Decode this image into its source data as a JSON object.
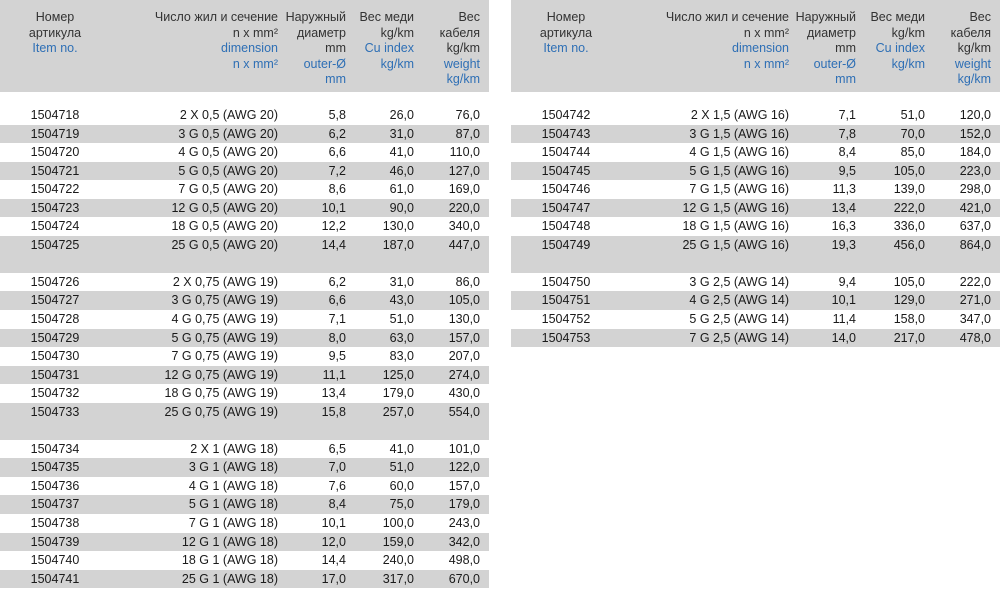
{
  "headers": {
    "item_ru": "Номер\nартикула",
    "item_en": "Item no.",
    "dim_ru": "Число жил и сечение\nn x mm²",
    "dim_en": "dimension\nn x mm²",
    "od_ru": "Наружный\nдиаметр\nmm",
    "od_en": "outer-Ø\nmm",
    "cu_ru": "Вес меди\nkg/km",
    "cu_en": "Cu index\nkg/km",
    "wt_ru": "Вес\nкабеля\nkg/km",
    "wt_en": "weight\nkg/km"
  },
  "left_groups": [
    [
      [
        "1504718",
        "2 X 0,5 (AWG 20)",
        "5,8",
        "26,0",
        "76,0"
      ],
      [
        "1504719",
        "3 G 0,5 (AWG 20)",
        "6,2",
        "31,0",
        "87,0"
      ],
      [
        "1504720",
        "4 G 0,5 (AWG 20)",
        "6,6",
        "41,0",
        "110,0"
      ],
      [
        "1504721",
        "5 G 0,5 (AWG 20)",
        "7,2",
        "46,0",
        "127,0"
      ],
      [
        "1504722",
        "7 G 0,5 (AWG 20)",
        "8,6",
        "61,0",
        "169,0"
      ],
      [
        "1504723",
        "12 G 0,5 (AWG 20)",
        "10,1",
        "90,0",
        "220,0"
      ],
      [
        "1504724",
        "18 G 0,5 (AWG 20)",
        "12,2",
        "130,0",
        "340,0"
      ],
      [
        "1504725",
        "25 G 0,5 (AWG 20)",
        "14,4",
        "187,0",
        "447,0"
      ]
    ],
    [
      [
        "1504726",
        "2 X 0,75 (AWG 19)",
        "6,2",
        "31,0",
        "86,0"
      ],
      [
        "1504727",
        "3 G 0,75 (AWG 19)",
        "6,6",
        "43,0",
        "105,0"
      ],
      [
        "1504728",
        "4 G 0,75 (AWG 19)",
        "7,1",
        "51,0",
        "130,0"
      ],
      [
        "1504729",
        "5 G 0,75 (AWG 19)",
        "8,0",
        "63,0",
        "157,0"
      ],
      [
        "1504730",
        "7 G 0,75 (AWG 19)",
        "9,5",
        "83,0",
        "207,0"
      ],
      [
        "1504731",
        "12 G 0,75 (AWG 19)",
        "11,1",
        "125,0",
        "274,0"
      ],
      [
        "1504732",
        "18 G 0,75 (AWG 19)",
        "13,4",
        "179,0",
        "430,0"
      ],
      [
        "1504733",
        "25 G 0,75 (AWG 19)",
        "15,8",
        "257,0",
        "554,0"
      ]
    ],
    [
      [
        "1504734",
        "2 X 1 (AWG 18)",
        "6,5",
        "41,0",
        "101,0"
      ],
      [
        "1504735",
        "3 G 1 (AWG 18)",
        "7,0",
        "51,0",
        "122,0"
      ],
      [
        "1504736",
        "4 G 1 (AWG 18)",
        "7,6",
        "60,0",
        "157,0"
      ],
      [
        "1504737",
        "5 G 1 (AWG 18)",
        "8,4",
        "75,0",
        "179,0"
      ],
      [
        "1504738",
        "7 G 1 (AWG 18)",
        "10,1",
        "100,0",
        "243,0"
      ],
      [
        "1504739",
        "12 G 1 (AWG 18)",
        "12,0",
        "159,0",
        "342,0"
      ],
      [
        "1504740",
        "18 G 1 (AWG 18)",
        "14,4",
        "240,0",
        "498,0"
      ],
      [
        "1504741",
        "25 G 1 (AWG 18)",
        "17,0",
        "317,0",
        "670,0"
      ]
    ]
  ],
  "right_groups": [
    [
      [
        "1504742",
        "2 X 1,5 (AWG 16)",
        "7,1",
        "51,0",
        "120,0"
      ],
      [
        "1504743",
        "3 G 1,5 (AWG 16)",
        "7,8",
        "70,0",
        "152,0"
      ],
      [
        "1504744",
        "4 G 1,5 (AWG 16)",
        "8,4",
        "85,0",
        "184,0"
      ],
      [
        "1504745",
        "5 G 1,5 (AWG 16)",
        "9,5",
        "105,0",
        "223,0"
      ],
      [
        "1504746",
        "7 G 1,5 (AWG 16)",
        "11,3",
        "139,0",
        "298,0"
      ],
      [
        "1504747",
        "12 G 1,5 (AWG 16)",
        "13,4",
        "222,0",
        "421,0"
      ],
      [
        "1504748",
        "18 G 1,5 (AWG 16)",
        "16,3",
        "336,0",
        "637,0"
      ],
      [
        "1504749",
        "25 G 1,5 (AWG 16)",
        "19,3",
        "456,0",
        "864,0"
      ]
    ],
    [
      [
        "1504750",
        "3 G 2,5 (AWG 14)",
        "9,4",
        "105,0",
        "222,0"
      ],
      [
        "1504751",
        "4 G 2,5 (AWG 14)",
        "10,1",
        "129,0",
        "271,0"
      ],
      [
        "1504752",
        "5 G 2,5 (AWG 14)",
        "11,4",
        "158,0",
        "347,0"
      ],
      [
        "1504753",
        "7 G 2,5 (AWG 14)",
        "14,0",
        "217,0",
        "478,0"
      ]
    ]
  ]
}
